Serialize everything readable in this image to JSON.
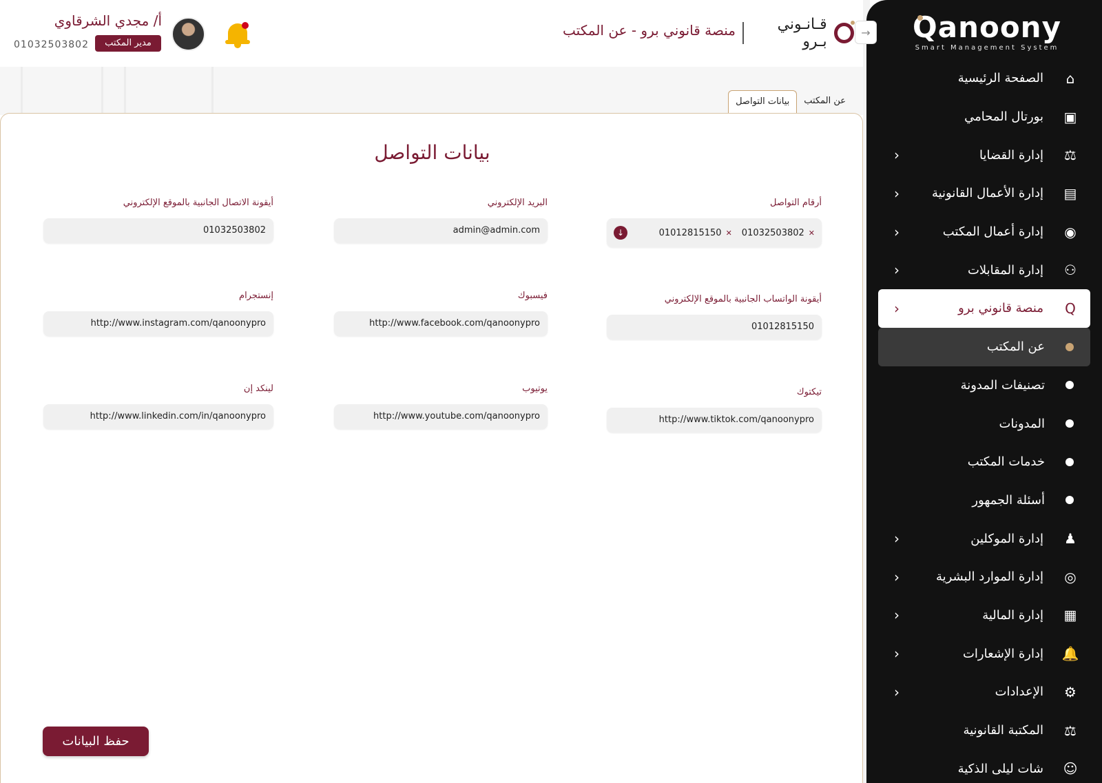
{
  "header": {
    "brand_name": "قـانـوني بـرو",
    "page_heading": "منصة قانوني برو - عن المكتب",
    "user_name": "أ/ مجدي الشرقاوي",
    "user_role": "مدير المكتب",
    "user_phone": "01032503802"
  },
  "logo": {
    "word": "Qanoony",
    "tagline": "Smart Management System"
  },
  "sidebar": {
    "items": [
      {
        "label": "الصفحة الرئيسية",
        "icon": "home-icon",
        "glyph": "⌂",
        "chevron": false
      },
      {
        "label": "بورتال المحامي",
        "icon": "portal-icon",
        "glyph": "▣",
        "chevron": false
      },
      {
        "label": "إدارة القضايا",
        "icon": "scales-icon",
        "glyph": "⚖",
        "chevron": true
      },
      {
        "label": "إدارة الأعمال القانونية",
        "icon": "legal-doc-icon",
        "glyph": "▤",
        "chevron": true
      },
      {
        "label": "إدارة أعمال المكتب",
        "icon": "office-icon",
        "glyph": "◉",
        "chevron": true
      },
      {
        "label": "إدارة المقابلات",
        "icon": "meetings-icon",
        "glyph": "⚇",
        "chevron": true
      },
      {
        "label": "منصة قانوني برو",
        "icon": "qanoony-pro-icon",
        "glyph": "Q",
        "chevron": true,
        "active": true
      },
      {
        "label": "عن المكتب",
        "sub": true,
        "current": true
      },
      {
        "label": "تصنيفات المدونة",
        "sub": true
      },
      {
        "label": "المدونات",
        "sub": true
      },
      {
        "label": "خدمات المكتب",
        "sub": true
      },
      {
        "label": "أسئلة الجمهور",
        "sub": true
      },
      {
        "label": "إدارة الموكلين",
        "icon": "clients-icon",
        "glyph": "♟",
        "chevron": true
      },
      {
        "label": "إدارة الموارد البشرية",
        "icon": "hr-icon",
        "glyph": "◎",
        "chevron": true
      },
      {
        "label": "إدارة المالية",
        "icon": "finance-icon",
        "glyph": "▦",
        "chevron": true
      },
      {
        "label": "إدارة الإشعارات",
        "icon": "bell-icon",
        "glyph": "🔔",
        "chevron": true
      },
      {
        "label": "الإعدادات",
        "icon": "gear-icon",
        "glyph": "⚙",
        "chevron": true
      },
      {
        "label": "المكتبة القانونية",
        "icon": "library-icon",
        "glyph": "⚖",
        "chevron": false
      },
      {
        "label": "شات ليلى الذكية",
        "icon": "chat-avatar-icon",
        "glyph": "☺",
        "chevron": false
      }
    ]
  },
  "breadcrumb_tabs": {
    "about": "عن المكتب",
    "contact": "بيانات التواصل"
  },
  "card": {
    "title": "بيانات التواصل",
    "fields": {
      "contact_numbers": {
        "label": "أرقام التواصل",
        "chips": [
          "01032503802",
          "01012815150"
        ]
      },
      "email": {
        "label": "البريد الإلكتروني",
        "value": "admin@admin.com"
      },
      "side_call_icon": {
        "label": "أيقونة الاتصال الجانبية بالموقع الإلكتروني",
        "value": "01032503802"
      },
      "side_whatsapp_icon": {
        "label": "أيقونة الواتساب الجانبية بالموقع الإلكتروني",
        "value": "01012815150"
      },
      "facebook": {
        "label": "فيسبوك",
        "value": "http://www.facebook.com/qanoonypro"
      },
      "instagram": {
        "label": "إنستجرام",
        "value": "http://www.instagram.com/qanoonypro"
      },
      "tiktok": {
        "label": "تيكتوك",
        "value": "http://www.tiktok.com/qanoonypro"
      },
      "youtube": {
        "label": "يوتيوب",
        "value": "http://www.youtube.com/qanoonypro"
      },
      "linkedin": {
        "label": "لينكد إن",
        "value": "http://www.linkedin.com/in/qanoonypro"
      }
    },
    "save_label": "حفظ البيانات"
  },
  "colors": {
    "primary": "#7a1b33",
    "accent": "#c8a373",
    "sidebar_bg": "#121212",
    "bell": "#f5b400"
  }
}
